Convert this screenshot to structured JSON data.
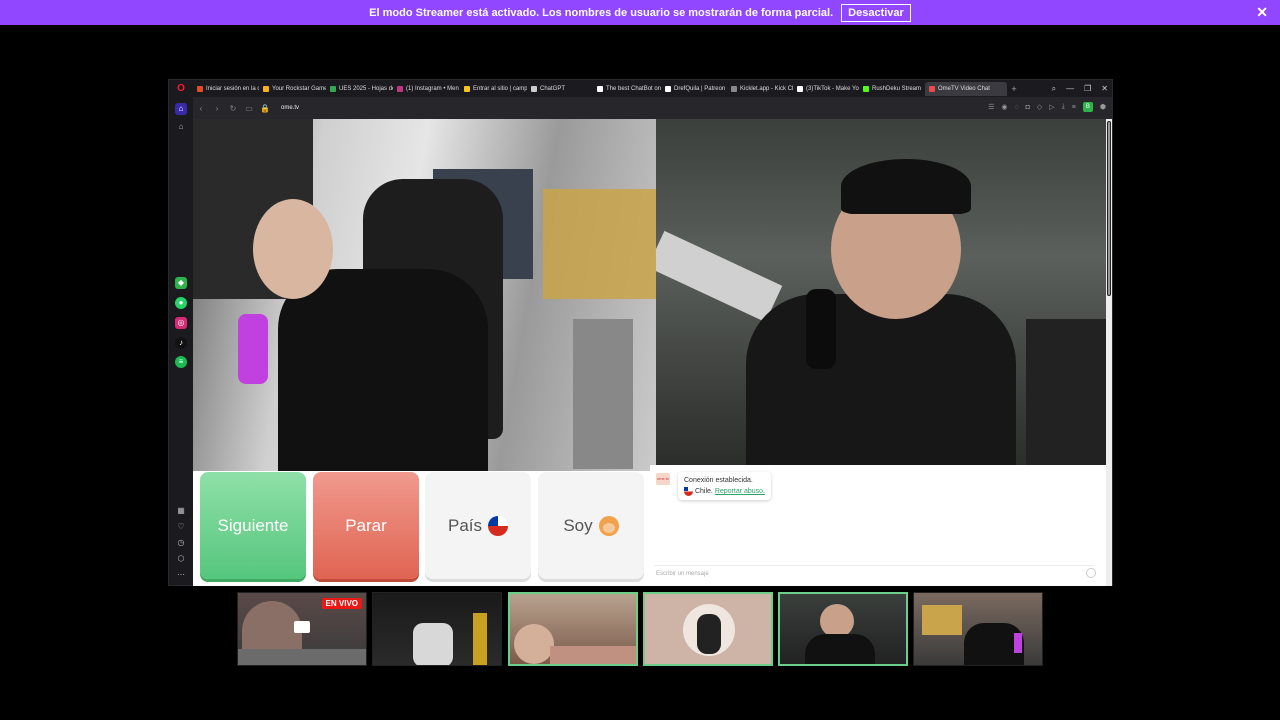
{
  "banner": {
    "message": "El modo Streamer está activado. Los nombres de usuario se mostrarán de forma parcial.",
    "action": "Desactivar",
    "close": "✕"
  },
  "browser": {
    "tabs": [
      {
        "label": "Iniciar sesión en la c",
        "color": "#e34c26"
      },
      {
        "label": "Your Rockstar Games",
        "color": "#fcaf17"
      },
      {
        "label": "UES 2025 - Hojas de",
        "color": "#34a853"
      },
      {
        "label": "(1) Instagram • Men",
        "color": "#c13584"
      },
      {
        "label": "Entrar al sitio | camp",
        "color": "#f5c518"
      },
      {
        "label": "ChatGPT",
        "color": "#cccccc"
      },
      {
        "label": "The best ChatBot on",
        "color": "#ffffff"
      },
      {
        "label": "DrefQuila | Patreon",
        "color": "#ffffff"
      },
      {
        "label": "Kicklet.app - Kick Ch",
        "color": "#888888"
      },
      {
        "label": "(3)TikTok - Make Yo",
        "color": "#ffffff"
      },
      {
        "label": "RushDeku Stream",
        "color": "#53fc18"
      },
      {
        "label": "OmeTV Video Chat",
        "color": "#e84b4b"
      }
    ],
    "url": "ome.tv",
    "profile_initial": "B"
  },
  "ometv": {
    "buttons": {
      "next": "Siguiente",
      "stop": "Parar",
      "country": "País",
      "soy": "Soy"
    },
    "chat": {
      "logo": "ome tv",
      "connected": "Conexión establecida.",
      "country": "Chile.",
      "report": "Reportar abuso.",
      "placeholder": "Escribir un mensaje"
    }
  },
  "thumbnails": {
    "live_badge": "EN VIVO"
  },
  "colors": {
    "banner": "#9147ff",
    "next": "#56c67d",
    "stop": "#e06452",
    "live": "#e91916"
  }
}
